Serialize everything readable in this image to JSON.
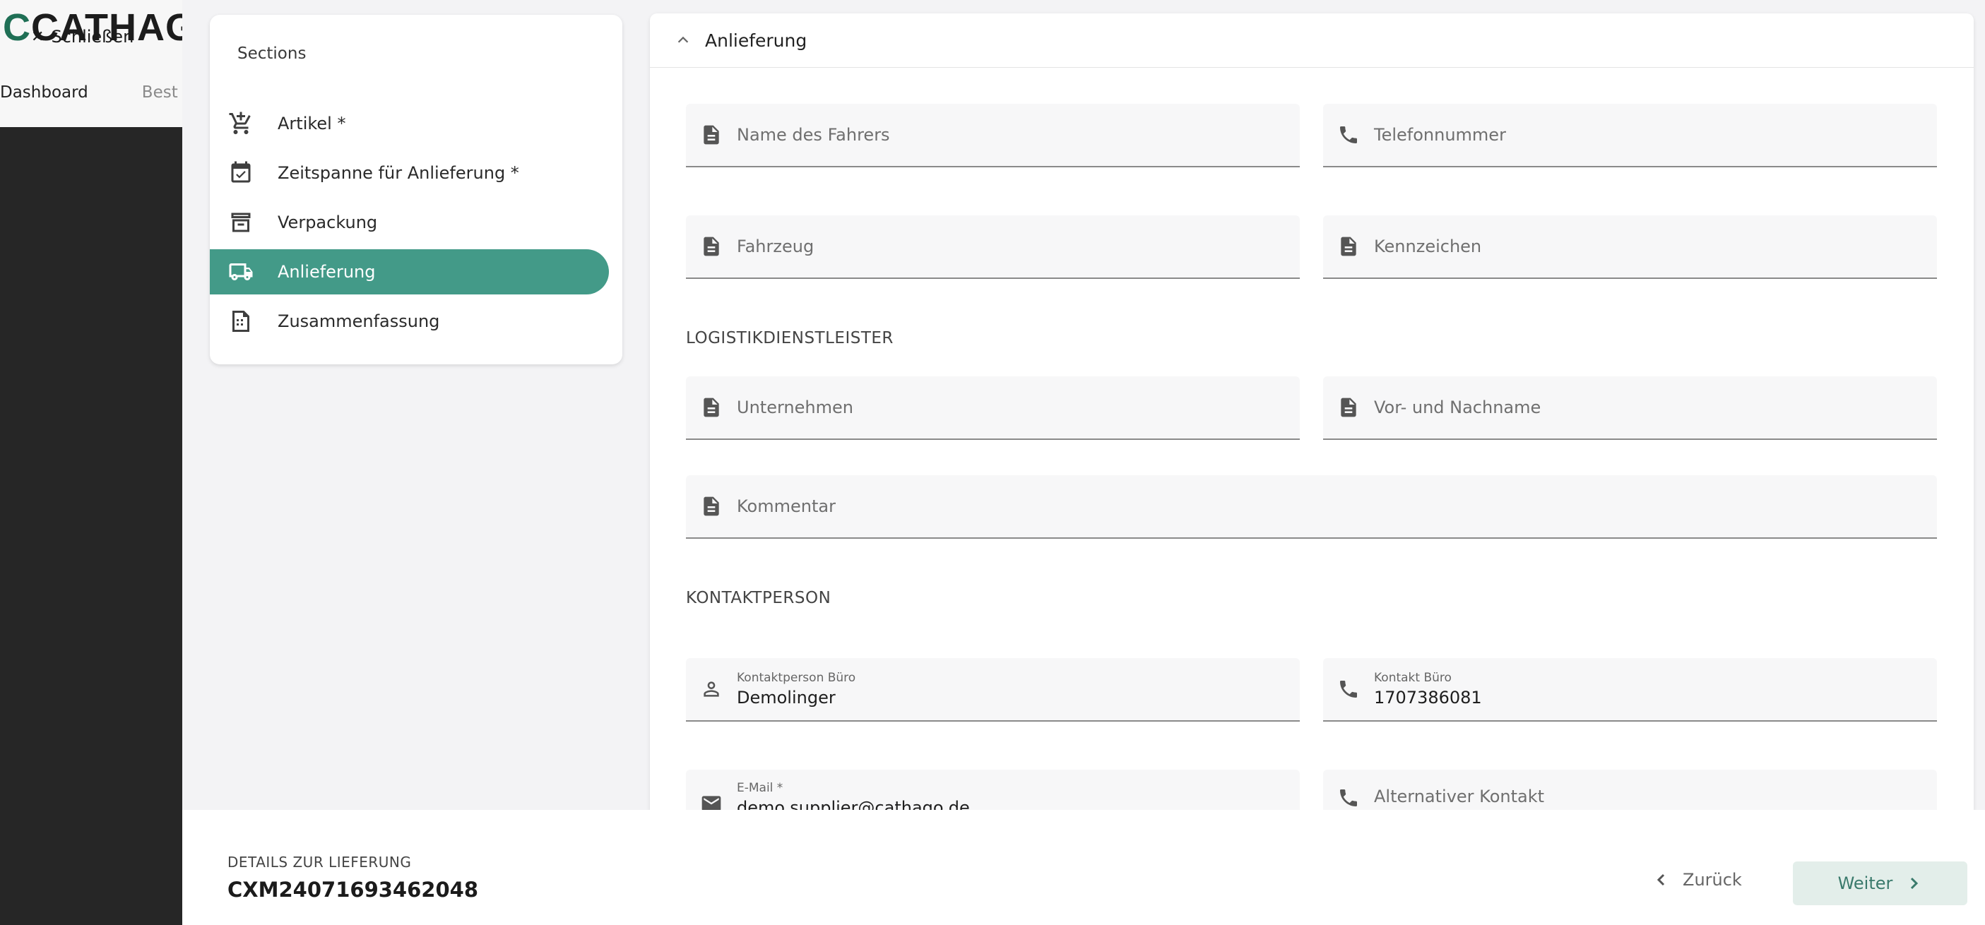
{
  "app": {
    "logo_text": "CATHAG",
    "close_label": "Schließen",
    "background_nav": [
      "Dashboard",
      "Best"
    ]
  },
  "sections": {
    "title": "Sections",
    "items": [
      {
        "label": "Artikel *",
        "icon": "cart-add-icon",
        "active": false
      },
      {
        "label": "Zeitspanne für Anlieferung *",
        "icon": "calendar-check-icon",
        "active": false
      },
      {
        "label": "Verpackung",
        "icon": "archive-box-icon",
        "active": false
      },
      {
        "label": "Anlieferung",
        "icon": "truck-icon",
        "active": true
      },
      {
        "label": "Zusammenfassung",
        "icon": "summary-doc-icon",
        "active": false
      }
    ]
  },
  "panel": {
    "title": "Anlieferung",
    "fields": {
      "driver_name": {
        "placeholder": "Name des Fahrers"
      },
      "phone": {
        "placeholder": "Telefonnummer"
      },
      "vehicle": {
        "placeholder": "Fahrzeug"
      },
      "plate": {
        "placeholder": "Kennzeichen"
      },
      "company": {
        "placeholder": "Unternehmen"
      },
      "full_name": {
        "placeholder": "Vor- und Nachname"
      },
      "comment": {
        "placeholder": "Kommentar"
      },
      "contact_office": {
        "label": "Kontaktperson Büro",
        "value": "Demolinger"
      },
      "contact_phone": {
        "label": "Kontakt Büro",
        "value": "1707386081"
      },
      "email": {
        "label": "E-Mail *",
        "value": "demo.supplier@cathago.de"
      },
      "alt_contact": {
        "placeholder": "Alternativer Kontakt"
      }
    },
    "groups": {
      "logistics": "LOGISTIKDIENSTLEISTER",
      "contact": "KONTAKTPERSON"
    }
  },
  "footer": {
    "label": "DETAILS ZUR LIEFERUNG",
    "delivery_id": "CXM24071693462048",
    "back_label": "Zurück",
    "next_label": "Weiter"
  },
  "colors": {
    "accent": "#439a88",
    "next_button_bg": "#e3eeea",
    "sidebar_dark": "#262626"
  }
}
